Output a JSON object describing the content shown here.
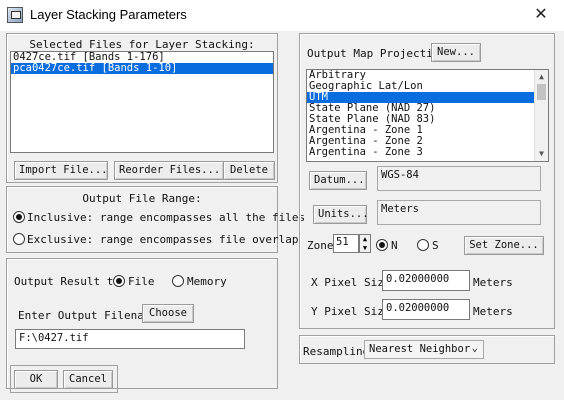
{
  "window": {
    "title": "Layer Stacking Parameters",
    "close_glyph": "✕"
  },
  "selected_files": {
    "header": "Selected Files for Layer Stacking:",
    "files": [
      {
        "label": "0427ce.tif [Bands 1-176]",
        "selected": false
      },
      {
        "label": "pca0427ce.tif [Bands 1-10]",
        "selected": true
      }
    ],
    "import_label": "Import File...",
    "reorder_label": "Reorder Files...",
    "delete_label": "Delete"
  },
  "range": {
    "header": "Output File Range:",
    "inclusive_label": "Inclusive: range encompasses all the files",
    "exclusive_label": "Exclusive: range encompasses file overlap",
    "selected": "inclusive"
  },
  "output": {
    "result_to_label": "Output Result to",
    "file_label": "File",
    "memory_label": "Memory",
    "selected": "file",
    "filename_label": "Enter Output Filename",
    "choose_label": "Choose",
    "filename_value": "F:\\0427.tif"
  },
  "dialog_buttons": {
    "ok_label": "OK",
    "cancel_label": "Cancel"
  },
  "projection": {
    "header": "Output Map Projection",
    "new_label": "New...",
    "items": [
      {
        "label": "Arbitrary",
        "selected": false
      },
      {
        "label": "Geographic Lat/Lon",
        "selected": false
      },
      {
        "label": "UTM",
        "selected": true
      },
      {
        "label": "State Plane (NAD 27)",
        "selected": false
      },
      {
        "label": "State Plane (NAD 83)",
        "selected": false
      },
      {
        "label": "Argentina - Zone 1",
        "selected": false
      },
      {
        "label": "Argentina - Zone 2",
        "selected": false
      },
      {
        "label": "Argentina - Zone 3",
        "selected": false
      }
    ],
    "datum_label": "Datum...",
    "datum_value": "WGS-84",
    "units_label": "Units...",
    "units_value": "Meters",
    "zone_label": "Zone",
    "zone_value": "51",
    "north_label": "N",
    "south_label": "S",
    "hemisphere": "N",
    "set_zone_label": "Set Zone...",
    "x_pixel_label": "X Pixel Size",
    "x_pixel_value": "0.02000000",
    "x_pixel_unit": "Meters",
    "y_pixel_label": "Y Pixel Size",
    "y_pixel_value": "0.02000000",
    "y_pixel_unit": "Meters"
  },
  "resampling": {
    "label": "Resampling",
    "value": "Nearest Neighbor"
  }
}
